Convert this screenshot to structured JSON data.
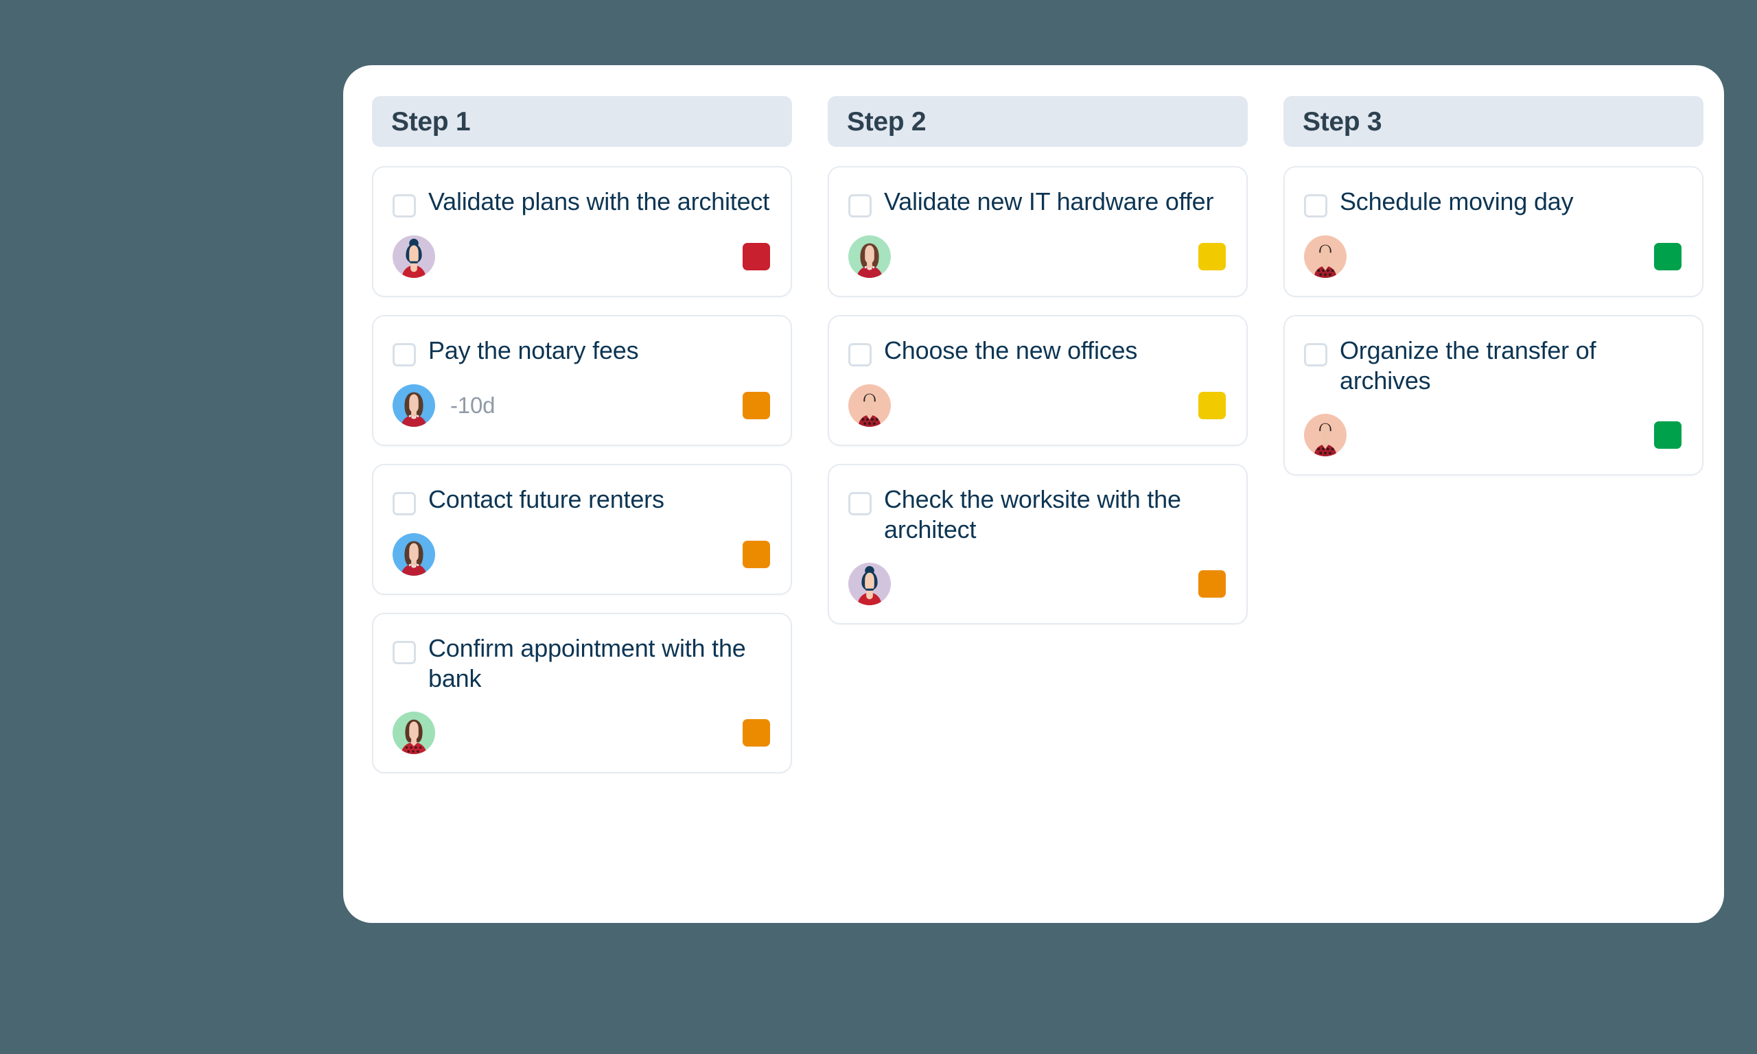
{
  "theme": {
    "page_background": "#4a6670",
    "board_background": "#ffffff",
    "column_header_background": "#e2e8f0",
    "column_header_text": "#2d4150",
    "card_background": "#ffffff",
    "card_border": "#e6ebf1",
    "card_title_text": "#0d3553",
    "checkbox_border": "#d8e0e8",
    "deadline_text": "#8f9aa6"
  },
  "status_colors": {
    "red": "#c8202f",
    "orange": "#ed8b00",
    "yellow": "#f2ca00",
    "green": "#00a14b"
  },
  "avatar_palettes": {
    "lavender_bun": {
      "bg": "#d3c4dd",
      "hair": "#123a5b",
      "skin": "#f6cdb3",
      "shirt": "#c8202f"
    },
    "blue_bob": {
      "bg": "#5cb3f0",
      "hair": "#5a3b2b",
      "skin": "#f2c9b4",
      "shirt": "#bc1f33"
    },
    "mint_bob": {
      "bg": "#a7e3bf",
      "hair": "#6b3f2c",
      "skin": "#f3cbb5",
      "shirt": "#bc1f33"
    },
    "peach_male": {
      "bg": "#f4c3ae",
      "hair": "#2b2220",
      "skin": "#f0c3ab",
      "shirt": "#a71c2c"
    },
    "mint_dots": {
      "bg": "#9fe0b7",
      "hair": "#5c3524",
      "skin": "#f3cbb5",
      "shirt": "#c0202f"
    }
  },
  "board": {
    "columns": [
      {
        "id": "step-1",
        "title": "Step 1",
        "cards": [
          {
            "title": "Validate plans with the architect",
            "checked": false,
            "avatar": "lavender_bun",
            "deadline": "",
            "status": "red"
          },
          {
            "title": "Pay the notary fees",
            "checked": false,
            "avatar": "blue_bob",
            "deadline": "-10d",
            "status": "orange"
          },
          {
            "title": "Contact future renters",
            "checked": false,
            "avatar": "blue_bob",
            "deadline": "",
            "status": "orange"
          },
          {
            "title": "Confirm appointment with the bank",
            "checked": false,
            "avatar": "mint_dots",
            "deadline": "",
            "status": "orange"
          }
        ]
      },
      {
        "id": "step-2",
        "title": "Step 2",
        "cards": [
          {
            "title": "Validate new IT hardware offer",
            "checked": false,
            "avatar": "mint_bob",
            "deadline": "",
            "status": "yellow"
          },
          {
            "title": "Choose the new offices",
            "checked": false,
            "avatar": "peach_male",
            "deadline": "",
            "status": "yellow"
          },
          {
            "title": "Check the worksite with the architect",
            "checked": false,
            "avatar": "lavender_bun",
            "deadline": "",
            "status": "orange"
          }
        ]
      },
      {
        "id": "step-3",
        "title": "Step 3",
        "cards": [
          {
            "title": "Schedule moving day",
            "checked": false,
            "avatar": "peach_male",
            "deadline": "",
            "status": "green"
          },
          {
            "title": "Organize the transfer of archives",
            "checked": false,
            "avatar": "peach_male",
            "deadline": "",
            "status": "green"
          }
        ]
      }
    ]
  }
}
